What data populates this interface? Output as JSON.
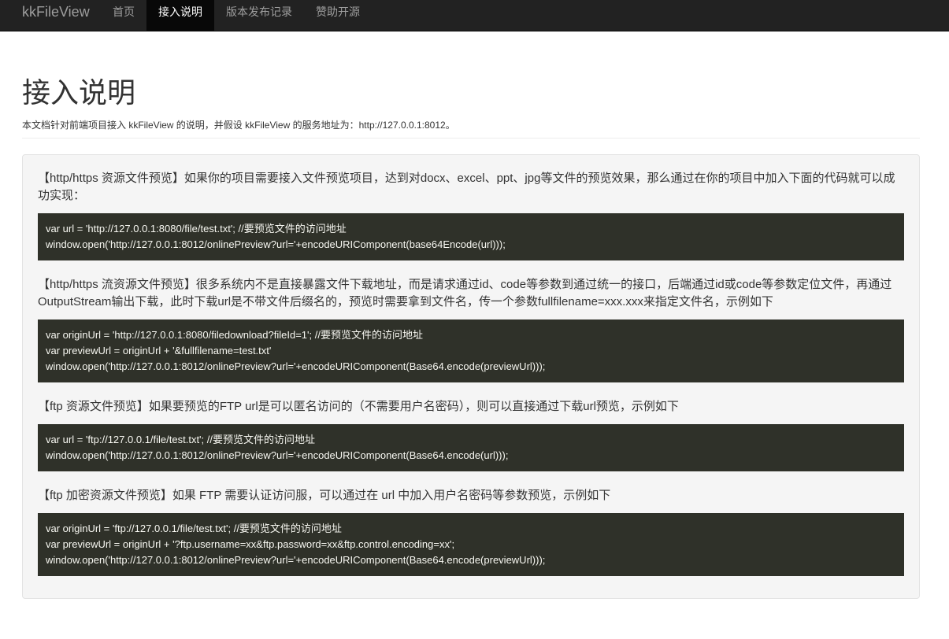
{
  "navbar": {
    "brand": "kkFileView",
    "items": [
      {
        "label": "首页"
      },
      {
        "label": "接入说明"
      },
      {
        "label": "版本发布记录"
      },
      {
        "label": "赞助开源"
      }
    ]
  },
  "page": {
    "title": "接入说明",
    "lead": "本文档针对前端项目接入 kkFileView 的说明，并假设 kkFileView 的服务地址为：http://127.0.0.1:8012。"
  },
  "sections": [
    {
      "desc": "【http/https 资源文件预览】如果你的项目需要接入文件预览项目，达到对docx、excel、ppt、jpg等文件的预览效果，那么通过在你的项目中加入下面的代码就可以成功实现：",
      "code": [
        "var url = 'http://127.0.0.1:8080/file/test.txt'; //要预览文件的访问地址",
        "window.open('http://127.0.0.1:8012/onlinePreview?url='+encodeURIComponent(base64Encode(url)));"
      ]
    },
    {
      "desc": "【http/https 流资源文件预览】很多系统内不是直接暴露文件下载地址，而是请求通过id、code等参数到通过统一的接口，后端通过id或code等参数定位文件，再通过OutputStream输出下载，此时下载url是不带文件后缀名的，预览时需要拿到文件名，传一个参数fullfilename=xxx.xxx来指定文件名，示例如下",
      "code": [
        "var originUrl = 'http://127.0.0.1:8080/filedownload?fileId=1'; //要预览文件的访问地址",
        "var previewUrl = originUrl + '&fullfilename=test.txt'",
        "window.open('http://127.0.0.1:8012/onlinePreview?url='+encodeURIComponent(Base64.encode(previewUrl)));"
      ]
    },
    {
      "desc": "【ftp 资源文件预览】如果要预览的FTP url是可以匿名访问的（不需要用户名密码），则可以直接通过下载url预览，示例如下",
      "code": [
        "var url = 'ftp://127.0.0.1/file/test.txt'; //要预览文件的访问地址",
        "window.open('http://127.0.0.1:8012/onlinePreview?url='+encodeURIComponent(Base64.encode(url)));"
      ]
    },
    {
      "desc": "【ftp 加密资源文件预览】如果 FTP 需要认证访问服，可以通过在 url 中加入用户名密码等参数预览，示例如下",
      "code": [
        "var originUrl = 'ftp://127.0.0.1/file/test.txt'; //要预览文件的访问地址",
        "var previewUrl = originUrl + '?ftp.username=xx&ftp.password=xx&ftp.control.encoding=xx';",
        "window.open('http://127.0.0.1:8012/onlinePreview?url='+encodeURIComponent(Base64.encode(previewUrl)));"
      ]
    }
  ]
}
